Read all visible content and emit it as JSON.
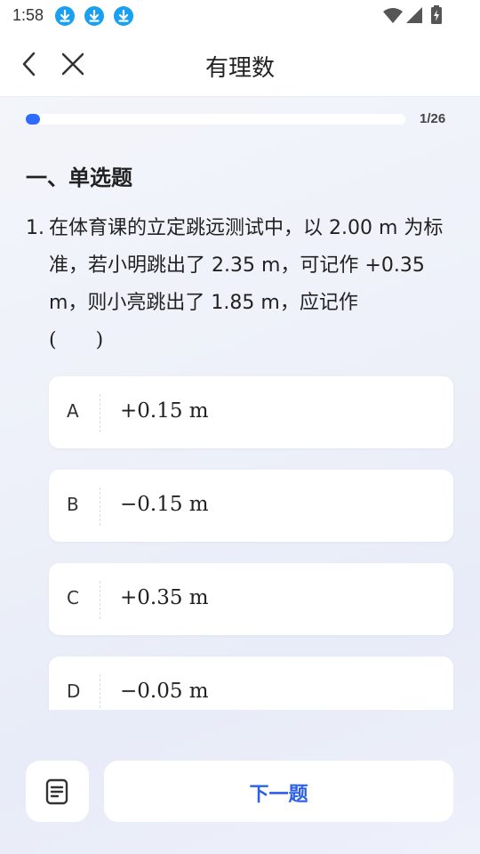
{
  "status_bar": {
    "time": "1:58",
    "notification_icons": [
      "download-icon",
      "download-icon",
      "download-icon"
    ],
    "system_icons": [
      "wifi-icon",
      "signal-icon",
      "battery-charging-icon"
    ]
  },
  "nav": {
    "title": "有理数",
    "back_icon": "chevron-left-icon",
    "close_icon": "close-icon"
  },
  "progress": {
    "current": 1,
    "total": 26,
    "label": "1/26",
    "fraction": 0.0385,
    "accent_color": "#2f6bff"
  },
  "section": {
    "title": "一、单选题"
  },
  "question": {
    "number": "1.",
    "text": "在体育课的立定跳远测试中，以 2.00 m 为标准，若小明跳出了 2.35 m，可记作 +0.35 m，则小亮跳出了 1.85 m，应记作",
    "blank": "(　　)"
  },
  "options": [
    {
      "letter": "A",
      "text": "+0.15 m"
    },
    {
      "letter": "B",
      "text": "−0.15 m"
    },
    {
      "letter": "C",
      "text": "+0.35 m"
    },
    {
      "letter": "D",
      "text": "−0.05 m"
    }
  ],
  "footer": {
    "notes_icon": "answer-sheet-icon",
    "next_label": "下一题",
    "next_color": "#2b5fe6"
  }
}
